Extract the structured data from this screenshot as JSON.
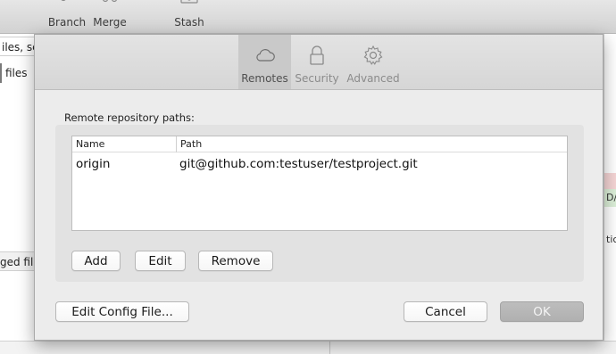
{
  "app_toolbar": {
    "items": [
      {
        "label": "Branch",
        "icon": "branch-icon"
      },
      {
        "label": "Merge",
        "icon": "merge-icon"
      },
      {
        "label": "Stash",
        "icon": "stash-icon"
      }
    ]
  },
  "sidebar": {
    "search_text": "iles, sc",
    "files_label": "files",
    "staged_label": "ged file"
  },
  "right_panel": {
    "snippet_1": "D/R",
    "snippet_2": "tic"
  },
  "dialog": {
    "tabs": [
      {
        "label": "Remotes",
        "icon": "cloud-icon",
        "active": true
      },
      {
        "label": "Security",
        "icon": "lock-icon",
        "active": false
      },
      {
        "label": "Advanced",
        "icon": "gear-icon",
        "active": false
      }
    ],
    "section_label": "Remote repository paths:",
    "table": {
      "columns": [
        "Name",
        "Path"
      ],
      "rows": [
        {
          "name": "origin",
          "path": "git@github.com:testuser/testproject.git"
        }
      ]
    },
    "buttons": {
      "add": "Add",
      "edit": "Edit",
      "remove": "Remove",
      "edit_config": "Edit Config File...",
      "cancel": "Cancel",
      "ok": "OK"
    }
  },
  "colors": {
    "dialog_bg": "#ececec",
    "active_tab_bg": "#c9c9c9",
    "ok_disabled_bg": "#b5b5b5"
  }
}
